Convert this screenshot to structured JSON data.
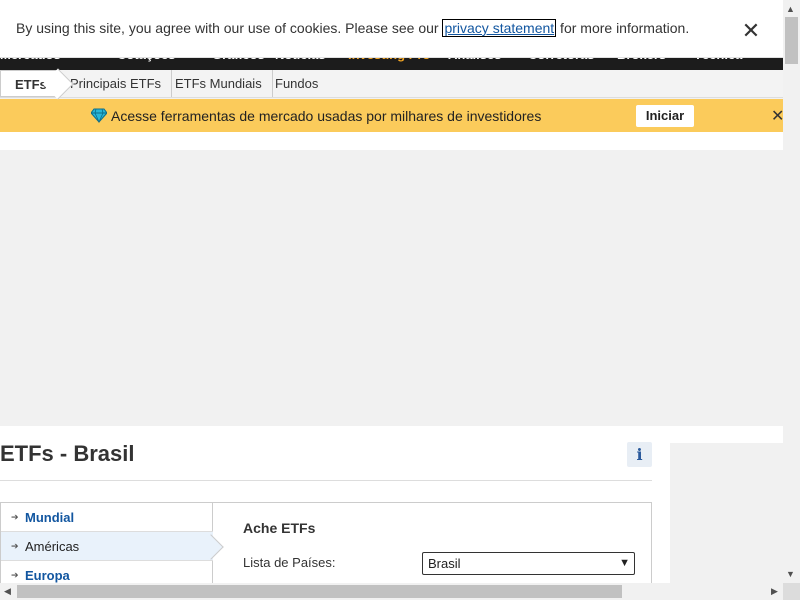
{
  "cookie_banner": {
    "text_before": "By using this site, you agree with our use of cookies. Please see our ",
    "link_text": "privacy statement",
    "text_after": " for more information."
  },
  "top_nav": {
    "items": [
      "Mercados",
      "Cotações",
      "Gráficos",
      "Notícias",
      "Investing Pro",
      "Análises",
      "Corretoras",
      "Brokers",
      "Técnica"
    ]
  },
  "sub_nav": {
    "items": [
      "ETFs",
      "Principais ETFs",
      "ETFs Mundiais",
      "Fundos"
    ]
  },
  "promo": {
    "text": "Acesse ferramentas de mercado usadas por milhares de investidores",
    "button_label": "Iniciar"
  },
  "page": {
    "title": "ETFs - Brasil",
    "info_icon": "i"
  },
  "regions": [
    "Mundial",
    "Américas",
    "Europa"
  ],
  "finder": {
    "title": "Ache ETFs",
    "country_label": "Lista de Países:",
    "country_value": "Brasil"
  },
  "colors": {
    "promo_background": "#fbcb5b",
    "link": "#1256a0",
    "nav_background": "#1c1c1c"
  }
}
